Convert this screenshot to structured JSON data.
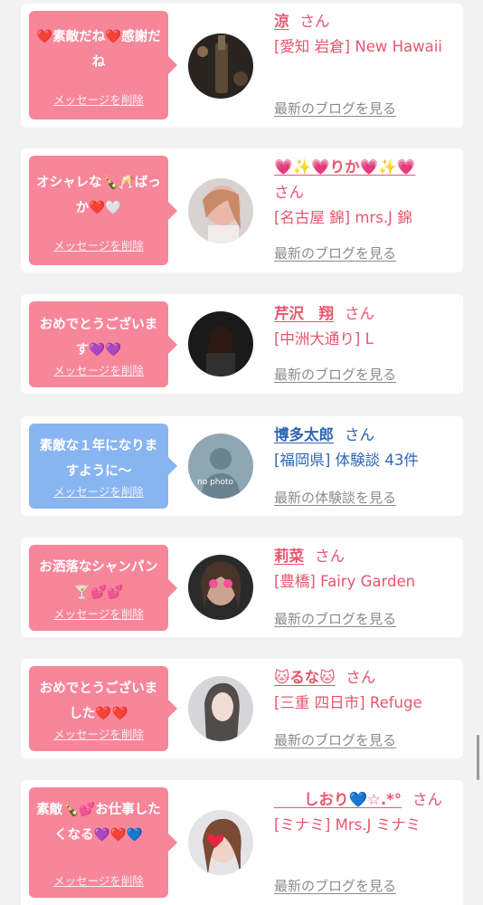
{
  "cards": [
    {
      "message": "❤️素敵だね❤️感謝だね",
      "delete_label": "メッセージを削除",
      "name": "涼",
      "honorific": "さん",
      "shop": "[愛知 岩倉] New Hawaii",
      "latest_link": "最新のブログを見る"
    },
    {
      "message": "オシャレな🍾🥂ばっか❤️🤍",
      "delete_label": "メッセージを削除",
      "name": "💗✨💗りか💗✨💗",
      "honorific": "さん",
      "shop": "[名古屋 錦] mrs.J 錦",
      "latest_link": "最新のブログを見る"
    },
    {
      "message": "おめでとうございます💜💜",
      "delete_label": "メッセージを削除",
      "name": "芹沢　翔",
      "honorific": "さん",
      "shop": "[中洲大通り] L",
      "latest_link": "最新のブログを見る"
    },
    {
      "message": "素敵な１年になりますように〜",
      "delete_label": "メッセージを削除",
      "name": "博多太郎",
      "honorific": "さん",
      "shop": "[福岡県] 体験談 43件",
      "latest_link": "最新の体験談を見る",
      "avatar_text": "no photo"
    },
    {
      "message": "お洒落なシャンパン🍸💕💕",
      "delete_label": "メッセージを削除",
      "name": "莉菜",
      "honorific": "さん",
      "shop": "[豊橋] Fairy Garden",
      "latest_link": "最新のブログを見る"
    },
    {
      "message": "おめでとうございました❤️❤️",
      "delete_label": "メッセージを削除",
      "name": "🐱るな🐱",
      "honorific": "さん",
      "shop": "[三重 四日市] Refuge",
      "latest_link": "最新のブログを見る"
    },
    {
      "message": "素敵🍾💕お仕事したくなる💜❤️💙",
      "delete_label": "メッセージを削除",
      "name": "　　しおり💙☆.*°",
      "honorific": "さん",
      "shop": "[ミナミ] Mrs.J ミナミ",
      "latest_link": "最新のブログを見る"
    }
  ],
  "colors": {
    "pink_bubble": "#f7869a",
    "blue_bubble": "#88b5f2",
    "pink_text": "#e8556e",
    "blue_text": "#2d66b3"
  }
}
